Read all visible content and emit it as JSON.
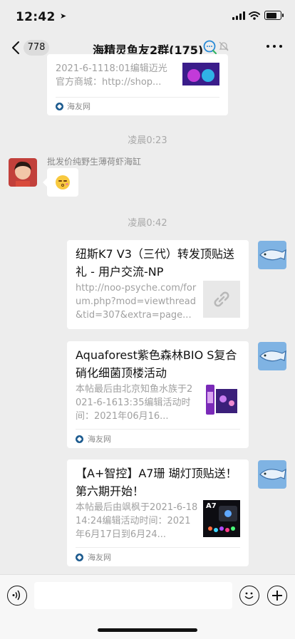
{
  "status": {
    "time": "12:42"
  },
  "nav": {
    "count": "778",
    "title": "海精灵鱼友2群(175)"
  },
  "messages": {
    "top_card": {
      "line1": "2021-6-1118:01编辑迈光",
      "line2": "官方商城：http://shop...",
      "source": "海友网"
    },
    "ts1": "凌晨0:23",
    "sender": "批发价纯野生薄荷虾海缸",
    "ts2": "凌晨0:42",
    "card1": {
      "title": "纽斯K7 V3（三代）转发顶贴送礼 - 用户交流-NP",
      "desc": "http://noo-psyche.com/forum.php?mod=viewthread&tid=307&extra=page..."
    },
    "card2": {
      "title": "Aquaforest紫色森林BIO S复合硝化细菌顶楼活动",
      "desc": "本帖最后由北京知鱼水族于2021-6-1613:35编辑活动时间：2021年06月16...",
      "source": "海友网"
    },
    "card3": {
      "title": "【A+智控】A7珊 瑚灯顶贴送！第六期开始！",
      "desc": "本帖最后由飒枫于2021-6-1814:24编辑活动时间：2021年6月17日到6月24...",
      "source": "海友网",
      "thumb_text": "A7"
    }
  },
  "colors": {
    "background": "#ededed",
    "card": "#ffffff",
    "muted": "#a9a9a9",
    "accent_blue": "#2a8bd6"
  }
}
